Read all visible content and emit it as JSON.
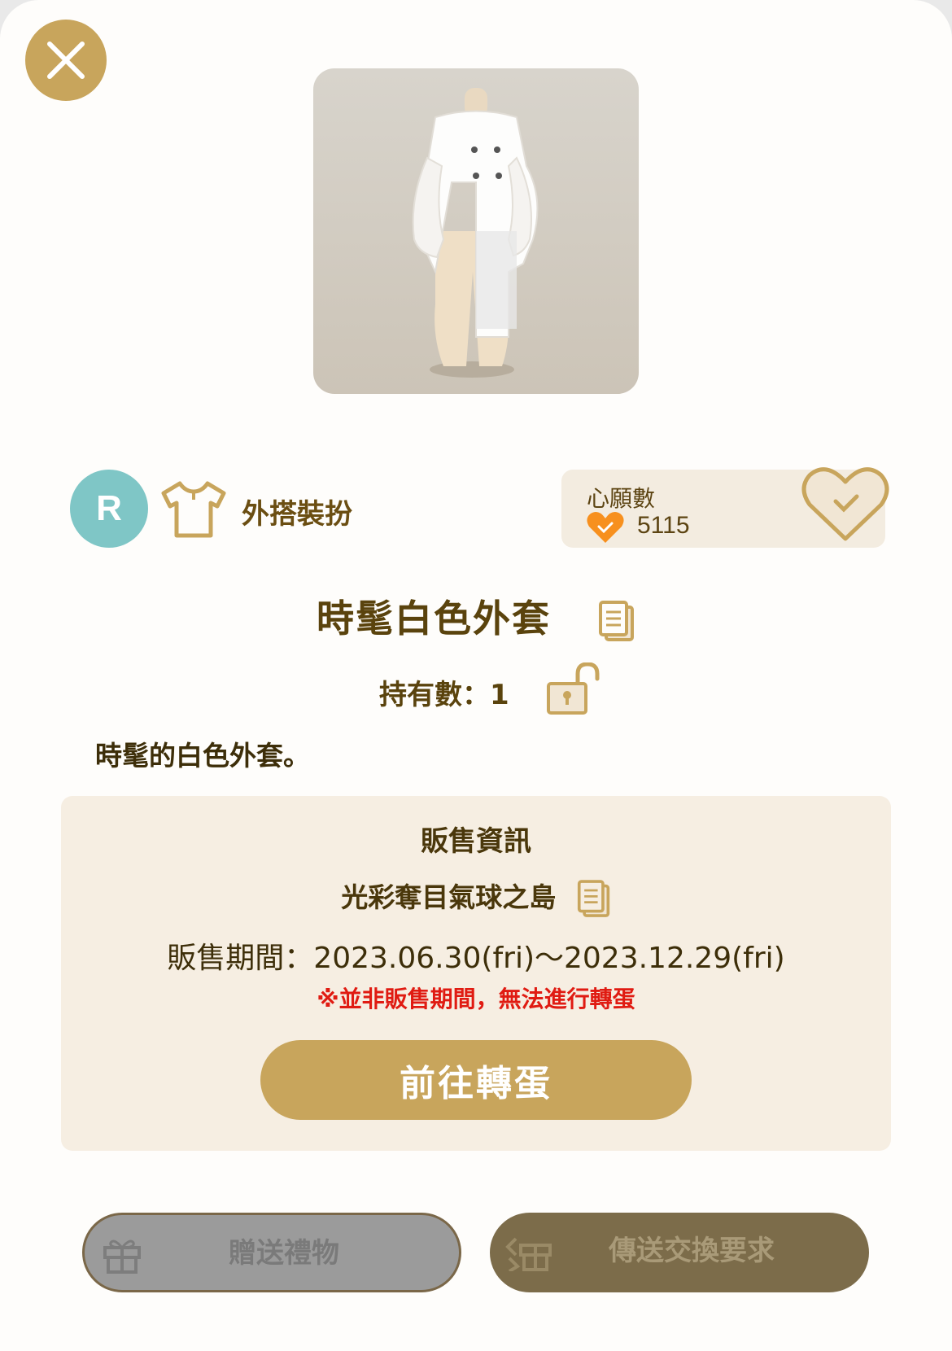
{
  "item": {
    "name": "時髦白色外套",
    "description": "時髦的白色外套。",
    "rarity": "R",
    "category": "外搭裝扮",
    "owned": "持有數：1"
  },
  "wishlist": {
    "title": "心願數",
    "count": "5115"
  },
  "sales": {
    "title": "販售資訊",
    "event": "光彩奪目氣球之島",
    "period": "販售期間：2023.06.30(fri)～2023.12.29(fri)",
    "warning": "※並非販售期間，無法進行轉蛋",
    "gacha_button": "前往轉蛋"
  },
  "actions": {
    "gift_label": "贈送禮物",
    "trade_label": "傳送交換要求"
  },
  "icons": {
    "close": "close-icon",
    "category": "shirt-icon",
    "copy": "copy-icon",
    "lock": "unlock-icon",
    "wish": "heart-check-icon",
    "gift": "gift-icon",
    "trade": "trade-icon"
  },
  "colors": {
    "accent": "#c8a55c",
    "text_brown": "#5a430d",
    "warning": "#e01b12",
    "rarity_teal": "#7fc6c6",
    "wish_orange": "#f7901e",
    "disabled_gray": "#9b9b9b",
    "trade_dark": "#7c6c4a"
  }
}
